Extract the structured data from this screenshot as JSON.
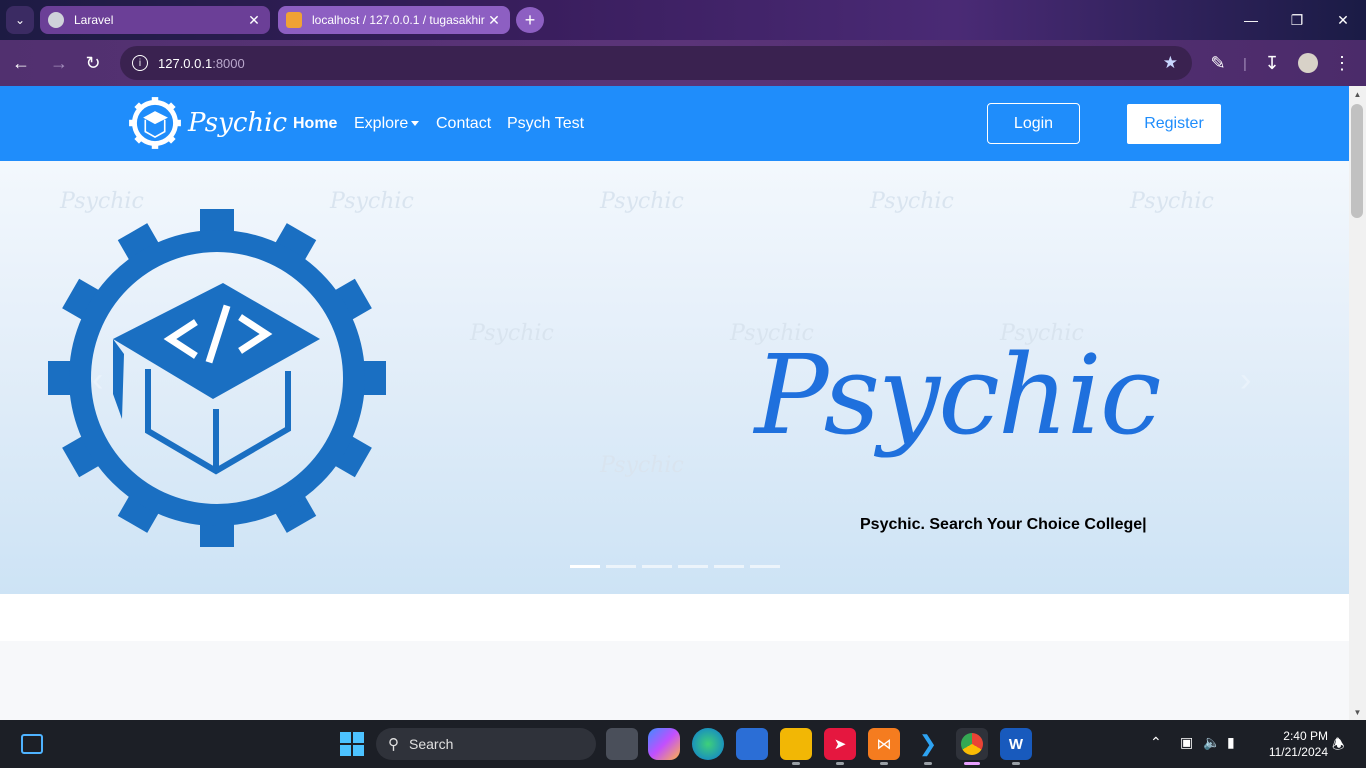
{
  "browser": {
    "tabs": [
      {
        "title": "Laravel",
        "active": true
      },
      {
        "title": "localhost / 127.0.0.1 / tugasakhir",
        "active": false
      }
    ],
    "url_host": "127.0.0.1",
    "url_port": ":8000"
  },
  "navbar": {
    "brand": "Psychic",
    "links": {
      "home": "Home",
      "explore": "Explore",
      "contact": "Contact",
      "psych_test": "Psych Test"
    },
    "login": "Login",
    "register": "Register"
  },
  "hero": {
    "title": "Psychic",
    "tagline": "Psychic. Search Your Choice College|",
    "watermark": "Psychic",
    "slide_count": 6,
    "active_slide": 1
  },
  "taskbar": {
    "search_placeholder": "Search",
    "time": "2:40 PM",
    "date": "11/21/2024"
  },
  "colors": {
    "brand_blue": "#1f8dfb",
    "title_blue": "#1f70dd",
    "logo_blue": "#1a6fc2"
  }
}
